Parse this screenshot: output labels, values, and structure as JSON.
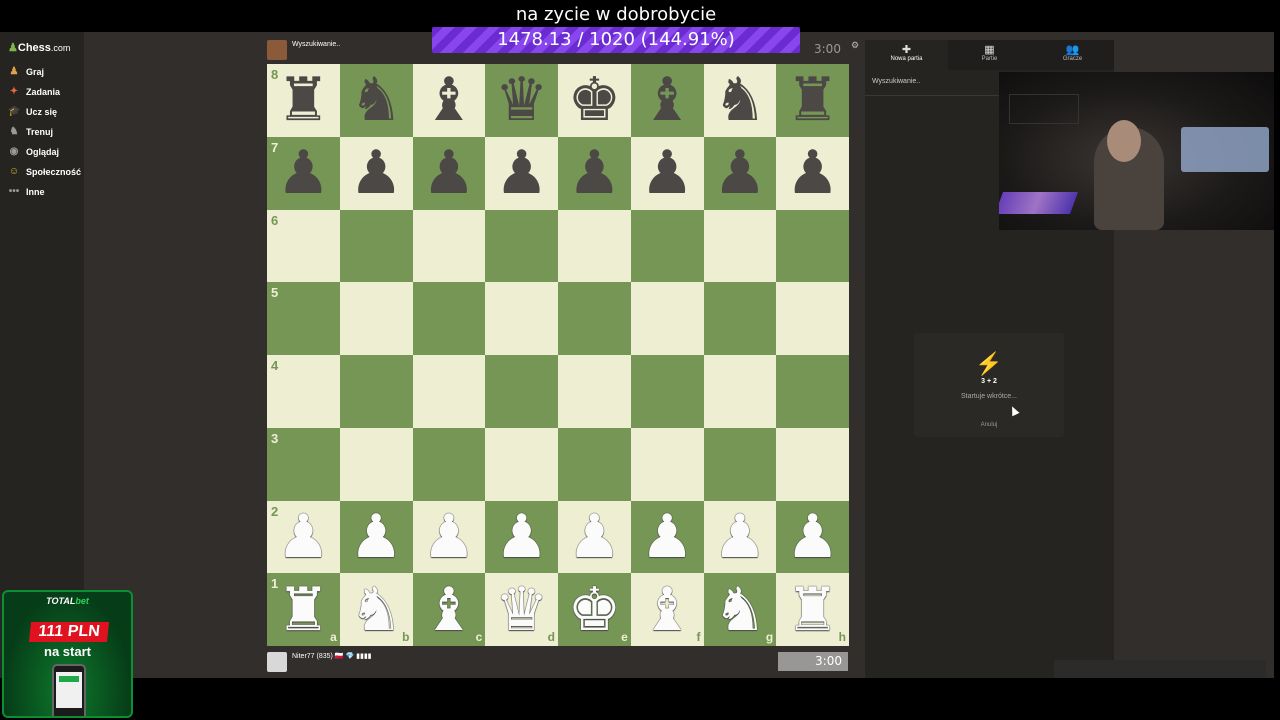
{
  "stream": {
    "goal_title": "na zycie w dobrobycie",
    "goal_progress": "1478.13 / 1020 (144.91%)"
  },
  "sidebar": {
    "logo": {
      "text": "Chess",
      "suffix": ".com"
    },
    "items": [
      {
        "label": "Graj",
        "icon": "play-icon",
        "color": "#e1a34a"
      },
      {
        "label": "Zadania",
        "icon": "puzzle-icon",
        "color": "#e36a3a"
      },
      {
        "label": "Ucz się",
        "icon": "learn-icon",
        "color": "#3ab3e3"
      },
      {
        "label": "Trenuj",
        "icon": "train-icon",
        "color": "#9a9a9a"
      },
      {
        "label": "Oglądaj",
        "icon": "watch-icon",
        "color": "#9a9a9a"
      },
      {
        "label": "Społeczność",
        "icon": "community-icon",
        "color": "#e3b13a"
      },
      {
        "label": "Inne",
        "icon": "more-icon",
        "color": "#9a9a9a"
      }
    ]
  },
  "opponent": {
    "name": "Wyszukiwanie..",
    "clock": "3:00"
  },
  "player": {
    "name": "Niter77 (835) 🇵🇱 💎 ▮▮▮▮",
    "clock": "3:00"
  },
  "board": {
    "files": [
      "a",
      "b",
      "c",
      "d",
      "e",
      "f",
      "g",
      "h"
    ],
    "ranks": [
      "8",
      "7",
      "6",
      "5",
      "4",
      "3",
      "2",
      "1"
    ],
    "position": [
      [
        "r",
        "n",
        "b",
        "q",
        "k",
        "b",
        "n",
        "r"
      ],
      [
        "p",
        "p",
        "p",
        "p",
        "p",
        "p",
        "p",
        "p"
      ],
      [
        "",
        "",
        "",
        "",
        "",
        "",
        "",
        ""
      ],
      [
        "",
        "",
        "",
        "",
        "",
        "",
        "",
        ""
      ],
      [
        "",
        "",
        "",
        "",
        "",
        "",
        "",
        ""
      ],
      [
        "",
        "",
        "",
        "",
        "",
        "",
        "",
        ""
      ],
      [
        "P",
        "P",
        "P",
        "P",
        "P",
        "P",
        "P",
        "P"
      ],
      [
        "R",
        "N",
        "B",
        "Q",
        "K",
        "B",
        "N",
        "R"
      ]
    ],
    "colors": {
      "light": "#eeeed2",
      "dark": "#769656"
    }
  },
  "right_panel": {
    "tabs": [
      {
        "label": "Nowa partia",
        "icon": "plus-icon",
        "glyph": "✚"
      },
      {
        "label": "Partie",
        "icon": "games-icon",
        "glyph": "▦"
      },
      {
        "label": "Gracze",
        "icon": "players-icon",
        "glyph": "👥"
      }
    ],
    "search_status": "Wyszukiwanie..",
    "seek": {
      "icon": "lightning-icon",
      "time_control": "3 + 2",
      "status": "Startuje wkrótce...",
      "cancel_label": "Anuluj"
    }
  },
  "promo": {
    "brand_a": "TOTAL",
    "brand_b": "bet",
    "amount": "111 PLN",
    "subtitle": "na start"
  }
}
